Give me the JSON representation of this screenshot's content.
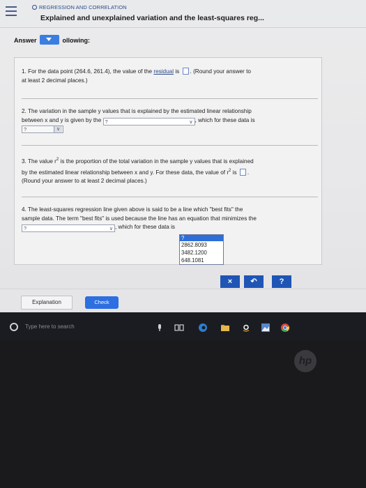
{
  "header": {
    "breadcrumb": "REGRESSION AND CORRELATION",
    "title": "Explained and unexplained variation and the least-squares reg..."
  },
  "prompt": {
    "left": "Answer",
    "right": "ollowing:"
  },
  "questions": {
    "q1": {
      "text_a": "1. For the data point (264.6, 261.4), the value of the ",
      "link": "residual",
      "text_b": " is ",
      "text_c": ". (Round your answer to",
      "text_d": "at least 2 decimal places.)"
    },
    "q2": {
      "line1": "2. The variation in the sample y values that is explained by the estimated linear relationship",
      "line2a": "between x and y is given by the ",
      "select_value": "?",
      "line2b": ", which for these data is",
      "select2_value": "?"
    },
    "q3": {
      "line1a": "3. The value r",
      "sup": "2",
      "line1b": " is the proportion of the total variation in the sample y values that is explained",
      "line2a": "by the estimated linear relationship between x and y. For these data, the value of r",
      "line2sup": "2",
      "line2b": " is ",
      "line2c": ".",
      "line3": "(Round your answer to at least 2 decimal places.)"
    },
    "q4": {
      "line1": "4. The least-squares regression line given above is said to be a line which \"best fits\" the",
      "line2": "sample data. The term \"best fits\" is used because the line has an equation that minimizes the",
      "select_value": "?",
      "line3": ", which for these data is",
      "options": [
        "?",
        "2862.8093",
        "3482.1200",
        "648.1081"
      ]
    }
  },
  "tools": {
    "clear": "×",
    "undo": "↶",
    "help": "?"
  },
  "buttons": {
    "explanation": "Explanation",
    "check": "Check"
  },
  "taskbar": {
    "search_placeholder": "Type here to search"
  },
  "brand": {
    "logo": "hp"
  },
  "colors": {
    "accent": "#2d6ee0",
    "tool": "#1f55b5",
    "taskbar": "#1b1c22"
  }
}
